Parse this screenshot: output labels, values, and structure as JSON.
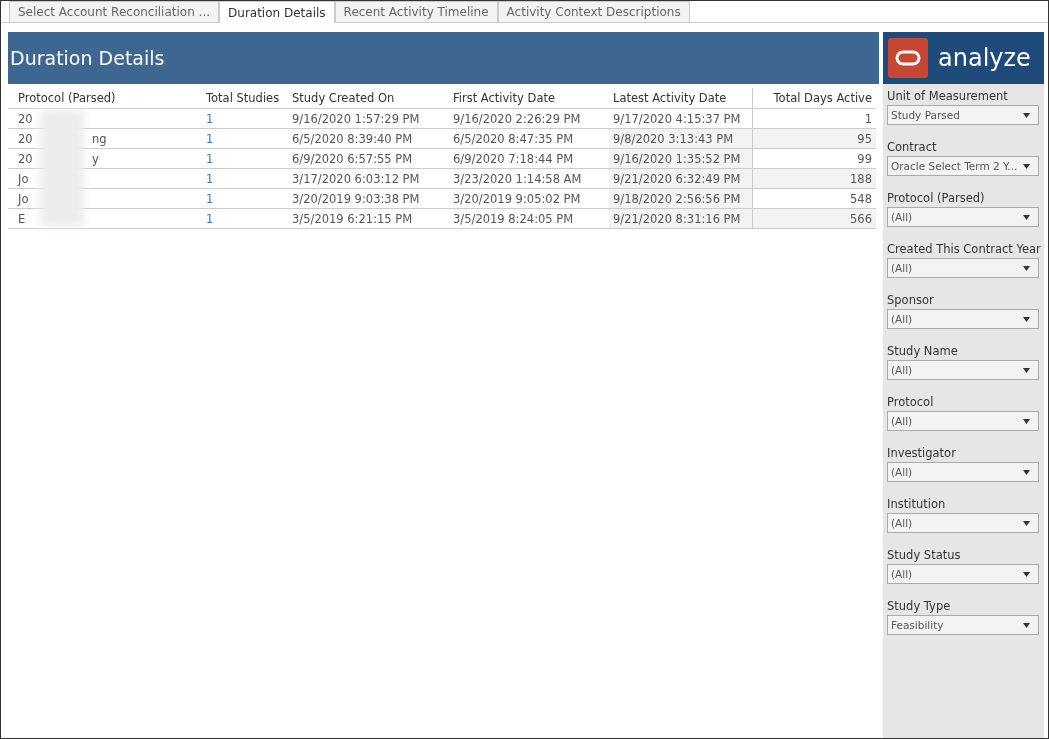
{
  "tabs": [
    {
      "label": "Select Account Reconciliation ...",
      "selected": false
    },
    {
      "label": "Duration Details",
      "selected": true
    },
    {
      "label": "Recent Activity Timeline",
      "selected": false
    },
    {
      "label": "Activity Context Descriptions",
      "selected": false
    }
  ],
  "header": {
    "title": "Duration Details"
  },
  "table": {
    "columns": [
      "Protocol (Parsed)",
      "Total Studies",
      "Study Created On",
      "First Activity Date",
      "Latest Activity Date",
      "Total Days Active"
    ],
    "rows": [
      {
        "protocol_start": "20",
        "protocol_end": "",
        "total_studies": "1",
        "created": "9/16/2020 1:57:29 PM",
        "first": "9/16/2020 2:26:29 PM",
        "latest": "9/17/2020 4:15:37 PM",
        "days": "1"
      },
      {
        "protocol_start": "20",
        "protocol_end": "ng",
        "total_studies": "1",
        "created": "6/5/2020 8:39:40 PM",
        "first": "6/5/2020 8:47:35 PM",
        "latest": "9/8/2020 3:13:43 PM",
        "days": "95"
      },
      {
        "protocol_start": "20",
        "protocol_end": "y",
        "total_studies": "1",
        "created": "6/9/2020 6:57:55 PM",
        "first": "6/9/2020 7:18:44 PM",
        "latest": "9/16/2020 1:35:52 PM",
        "days": "99"
      },
      {
        "protocol_start": "Jo",
        "protocol_end": "",
        "total_studies": "1",
        "created": "3/17/2020 6:03:12 PM",
        "first": "3/23/2020 1:14:58 AM",
        "latest": "9/21/2020 6:32:49 PM",
        "days": "188"
      },
      {
        "protocol_start": "Jo",
        "protocol_end": "",
        "total_studies": "1",
        "created": "3/20/2019 9:03:38 PM",
        "first": "3/20/2019 9:05:02 PM",
        "latest": "9/18/2020 2:56:56 PM",
        "days": "548"
      },
      {
        "protocol_start": "E",
        "protocol_end": "",
        "total_studies": "1",
        "created": "3/5/2019 6:21:15 PM",
        "first": "3/5/2019 8:24:05 PM",
        "latest": "9/21/2020 8:31:16 PM",
        "days": "566"
      }
    ]
  },
  "logo": {
    "text": "analyze"
  },
  "filters": [
    {
      "label": "Unit of Measurement",
      "value": "Study Parsed"
    },
    {
      "label": "Contract",
      "value": "Oracle Select Term 2 Y..."
    },
    {
      "label": "Protocol (Parsed)",
      "value": "(All)"
    },
    {
      "label": "Created This Contract Year",
      "value": "(All)"
    },
    {
      "label": "Sponsor",
      "value": "(All)"
    },
    {
      "label": "Study Name",
      "value": "(All)"
    },
    {
      "label": "Protocol",
      "value": "(All)"
    },
    {
      "label": "Investigator",
      "value": "(All)"
    },
    {
      "label": "Institution",
      "value": "(All)"
    },
    {
      "label": "Study Status",
      "value": "(All)"
    },
    {
      "label": "Study Type",
      "value": "Feasibility"
    }
  ]
}
